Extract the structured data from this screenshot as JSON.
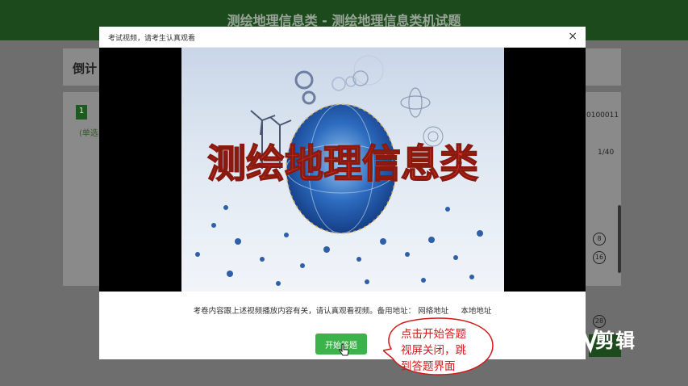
{
  "page": {
    "header_title": "测绘地理信息类 - 测绘地理信息类机试题",
    "countdown_label": "倒计",
    "question_number": "1",
    "question_type": "(单选",
    "exam_id": "0100011",
    "pagination": "1/40",
    "nav_badges": [
      "8",
      "16",
      "28"
    ]
  },
  "modal": {
    "title": "考试视频，请考生认真观看",
    "close_label": "×",
    "video_caption": "测绘地理信息类",
    "notice_text": "考卷内容跟上述视频播放内容有关，请认真观看视频。备用地址：",
    "link_network": "网络地址",
    "link_local": "本地地址",
    "start_button": "开始答题"
  },
  "annotation": {
    "callout_lines": [
      "点击开始答题",
      "视屏关闭，跳",
      "到答题界面"
    ]
  },
  "watermark": {
    "text": "剪辑"
  },
  "colors": {
    "header": "#1d4a1c",
    "start_button": "#3bb24a",
    "callout_text": "#d1181b"
  }
}
